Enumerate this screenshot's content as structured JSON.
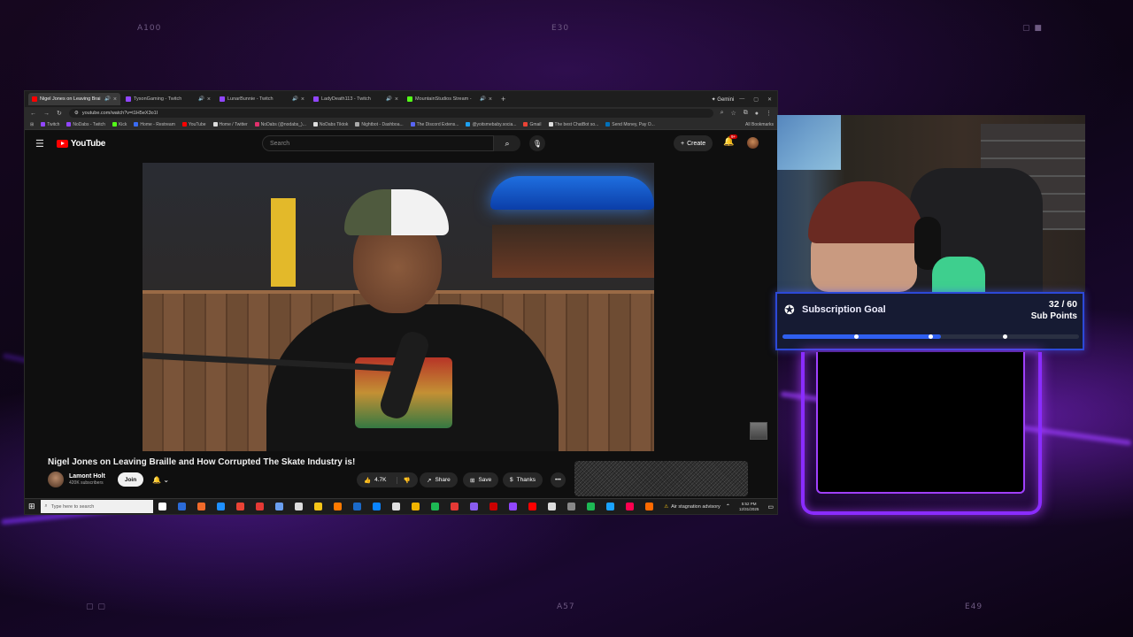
{
  "overlay": {
    "corner_tl": "A100",
    "corner_tc": "E30",
    "corner_bc": "A57",
    "corner_br": "E49"
  },
  "browser": {
    "tabs": [
      {
        "title": "Nigel Jones on Leaving Brai",
        "color": "#ff0000",
        "active": true
      },
      {
        "title": "TysonGaming - Twitch",
        "color": "#9146ff",
        "active": false
      },
      {
        "title": "LunarBunnie - Twitch",
        "color": "#9146ff",
        "active": false
      },
      {
        "title": "LadyDeath113 - Twitch",
        "color": "#9146ff",
        "active": false
      },
      {
        "title": "MountainStudios Stream -",
        "color": "#53fc18",
        "active": false
      }
    ],
    "new_tab": "+",
    "gemini_label": "Gemini",
    "url": "youtube.com/watch?v=t1H5eX3o1I",
    "bookmarks": [
      {
        "label": "Twitch",
        "color": "#9146ff"
      },
      {
        "label": "NoDabs - Twitch",
        "color": "#9146ff"
      },
      {
        "label": "Kick",
        "color": "#53fc18"
      },
      {
        "label": "Home - Restream",
        "color": "#3a6cf4"
      },
      {
        "label": "YouTube",
        "color": "#ff0000"
      },
      {
        "label": "Home / Twitter",
        "color": "#dddddd"
      },
      {
        "label": "NoDabs (@nodabs_)...",
        "color": "#e1306c"
      },
      {
        "label": "NoDabs Tiktok",
        "color": "#dddddd"
      },
      {
        "label": "Nightbot - Dashboa...",
        "color": "#aaaaaa"
      },
      {
        "label": "The Discord Extens...",
        "color": "#5865f2"
      },
      {
        "label": "@yoitsmebaby.socia...",
        "color": "#1da1f2"
      },
      {
        "label": "Gmail",
        "color": "#ea4335"
      },
      {
        "label": "The best ChatBot so...",
        "color": "#dddddd"
      },
      {
        "label": "Send Money, Pay O...",
        "color": "#0070ba"
      }
    ],
    "all_bookmarks": "All Bookmarks"
  },
  "youtube": {
    "logo_text": "YouTube",
    "search_placeholder": "Search",
    "create_label": "Create",
    "notif_count": "9+",
    "video_title": "Nigel Jones on Leaving Braille and How Corrupted The Skate Industry is!",
    "channel_name": "Lamont Holt",
    "channel_subs": "420K subscribers",
    "join_label": "Join",
    "like_count": "4.7K",
    "share_label": "Share",
    "save_label": "Save",
    "thanks_label": "Thanks",
    "more_label": "•••"
  },
  "taskbar": {
    "search_placeholder": "Type here to search",
    "advisory": "Air stagnation advisory",
    "time": "5:52 PM",
    "date": "12/31/2025"
  },
  "sub_goal": {
    "title": "Subscription Goal",
    "count": "32 / 60",
    "unit": "Sub Points",
    "current": 32,
    "target": 60,
    "milestones": [
      0.25,
      0.5,
      0.75
    ]
  }
}
